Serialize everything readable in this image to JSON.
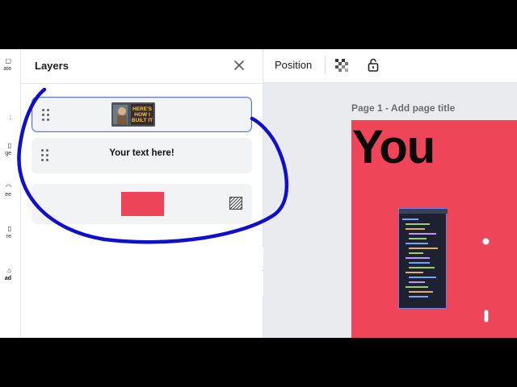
{
  "rail": {
    "items": [
      {
        "label": "ate",
        "bold": false
      },
      {
        "label": "",
        "bold": false
      },
      {
        "label": "ge",
        "bold": false
      },
      {
        "label": "ee",
        "bold": false
      },
      {
        "label": "re",
        "bold": false
      },
      {
        "label": "ad",
        "bold": true
      }
    ]
  },
  "panel": {
    "title": "Layers",
    "close_icon": "close-icon",
    "layers": [
      {
        "type": "image",
        "caption": "HERE'S HOW I BUILT IT",
        "selected": true
      },
      {
        "type": "text",
        "text": "Your text here!",
        "selected": false
      },
      {
        "type": "shape",
        "color": "#ed4459",
        "selected": false
      }
    ]
  },
  "toolbar": {
    "position_label": "Position",
    "transparency_icon": "transparency-icon",
    "lock_icon": "unlock-icon"
  },
  "canvas": {
    "page_label": "Page 1",
    "page_title_placeholder": "Add page title",
    "page_separator": " - ",
    "page_text": "You",
    "page_color": "#ee4559"
  },
  "annotation": {
    "color": "#1010cc"
  }
}
